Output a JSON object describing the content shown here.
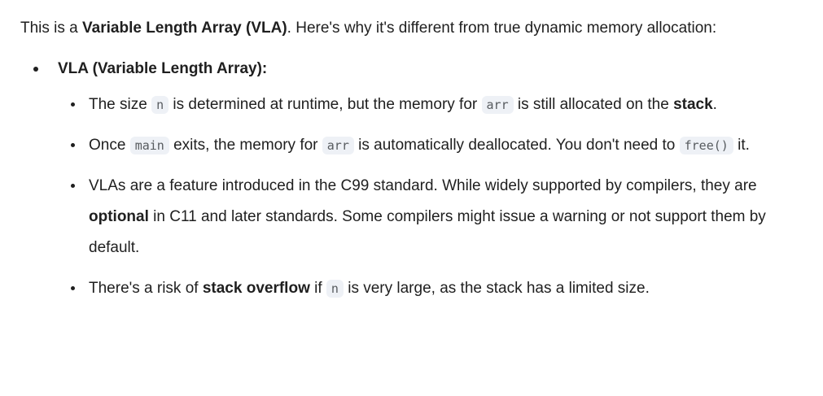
{
  "intro": {
    "prefix": "This is a ",
    "bold": "Variable Length Array (VLA)",
    "suffix": ". Here's why it's different from true dynamic memory allocation:"
  },
  "section": {
    "heading": "VLA (Variable Length Array):",
    "items": [
      {
        "t1": "The size ",
        "c1": "n",
        "t2": " is determined at runtime, but the memory for ",
        "c2": "arr",
        "t3": " is still allocated on the ",
        "b1": "stack",
        "t4": "."
      },
      {
        "t1": "Once ",
        "c1": "main",
        "t2": " exits, the memory for ",
        "c2": "arr",
        "t3": " is automatically deallocated. You don't need to ",
        "c3": "free()",
        "t4": " it."
      },
      {
        "t1": "VLAs are a feature introduced in the C99 standard. While widely supported by compilers, they are ",
        "b1": "optional",
        "t2": " in C11 and later standards. Some compilers might issue a warning or not support them by default."
      },
      {
        "t1": "There's a risk of ",
        "b1": "stack overflow",
        "t2": " if ",
        "c1": "n",
        "t3": " is very large, as the stack has a limited size."
      }
    ]
  }
}
